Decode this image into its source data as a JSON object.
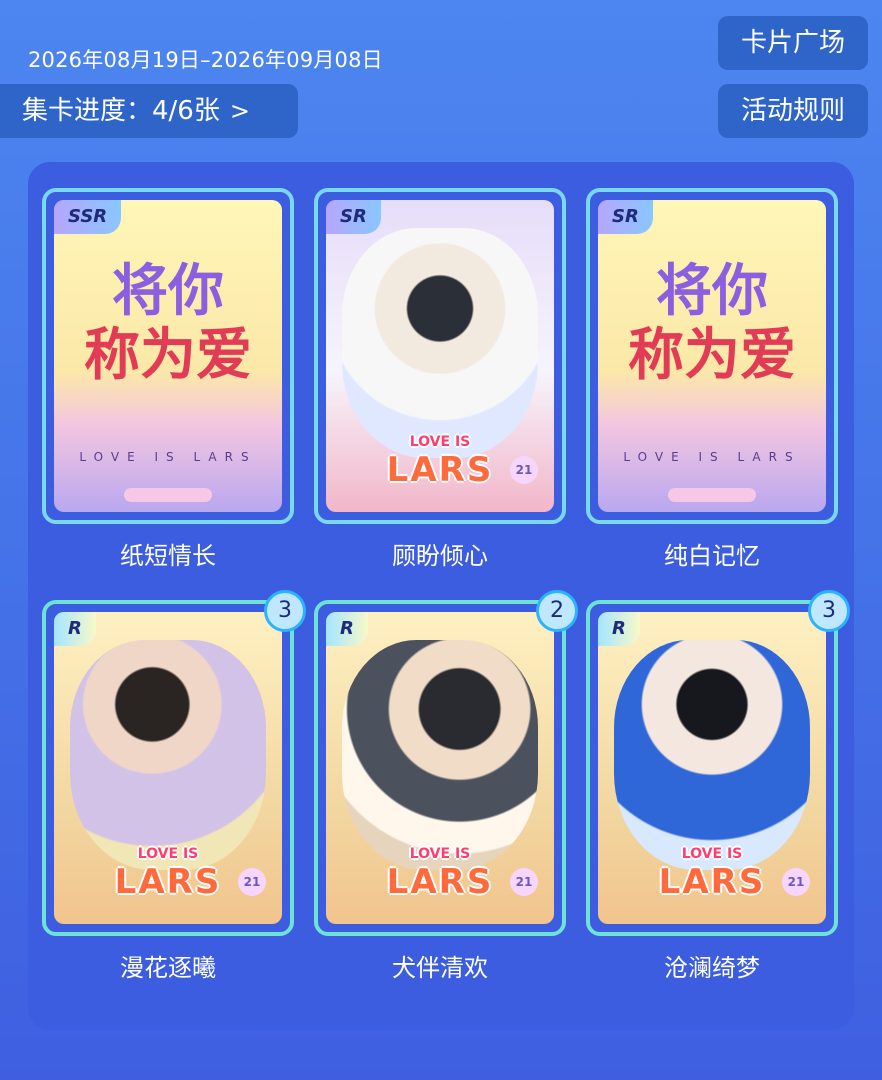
{
  "header": {
    "date_range": "2026年08月19日–2026年09月08日",
    "progress_label": "集卡进度：4/6张",
    "progress_chevron": ">",
    "buttons": {
      "card_plaza": "卡片广场",
      "rules": "活动规则"
    }
  },
  "cards": [
    {
      "name": "纸短情长",
      "rarity": "SSR",
      "count": "",
      "art_text_top": "将你",
      "art_text_bottom": "称为爱",
      "tagline": "LOVE  IS  LARS"
    },
    {
      "name": "顾盼倾心",
      "rarity": "SR",
      "count": "",
      "lars_small": "LOVE IS",
      "lars_big": "LARS",
      "badge": "21"
    },
    {
      "name": "纯白记忆",
      "rarity": "SR",
      "count": "",
      "art_text_top": "将你",
      "art_text_bottom": "称为爱",
      "tagline": "LOVE  IS  LARS"
    },
    {
      "name": "漫花逐曦",
      "rarity": "R",
      "count": "3",
      "lars_small": "LOVE IS",
      "lars_big": "LARS",
      "badge": "21"
    },
    {
      "name": "犬伴清欢",
      "rarity": "R",
      "count": "2",
      "lars_small": "LOVE IS",
      "lars_big": "LARS",
      "badge": "21"
    },
    {
      "name": "沧澜绮梦",
      "rarity": "R",
      "count": "3",
      "lars_small": "LOVE IS",
      "lars_big": "LARS",
      "badge": "21"
    }
  ]
}
